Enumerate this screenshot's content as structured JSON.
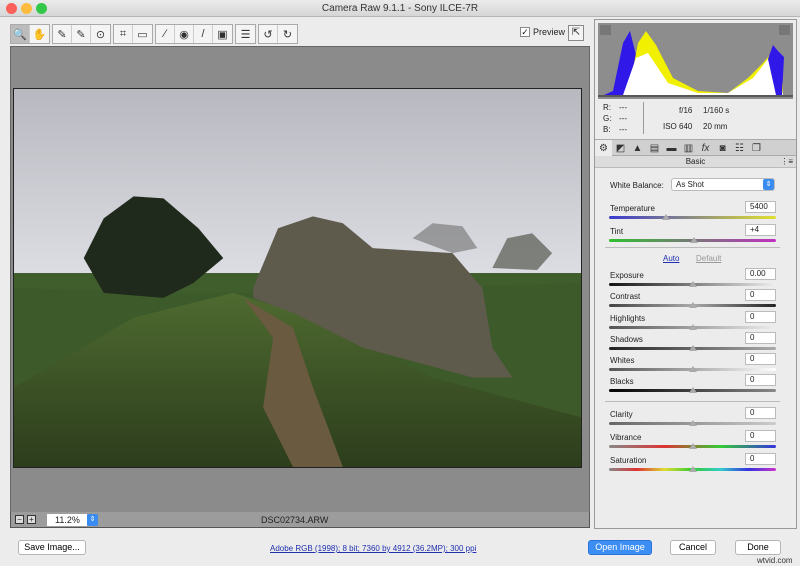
{
  "window": {
    "title": "Camera Raw 9.1.1  -  Sony ILCE-7R"
  },
  "toolbar": {
    "tools": [
      {
        "name": "zoom-tool",
        "glyph": "🔍"
      },
      {
        "name": "hand-tool",
        "glyph": "✋"
      },
      {
        "name": "white-balance-tool",
        "glyph": "✎"
      },
      {
        "name": "color-sampler-tool",
        "glyph": "✎"
      },
      {
        "name": "targeted-adjustment-tool",
        "glyph": "⊙"
      },
      {
        "name": "crop-tool",
        "glyph": "⌗"
      },
      {
        "name": "straighten-tool",
        "glyph": "▭"
      },
      {
        "name": "spot-removal-tool",
        "glyph": "⁄"
      },
      {
        "name": "red-eye-tool",
        "glyph": "◉"
      },
      {
        "name": "adjustment-brush-tool",
        "glyph": "/"
      },
      {
        "name": "graduated-filter-tool",
        "glyph": "▣"
      },
      {
        "name": "preferences-button",
        "glyph": "☰"
      },
      {
        "name": "rotate-left-button",
        "glyph": "↺"
      },
      {
        "name": "rotate-right-button",
        "glyph": "↻"
      }
    ],
    "preview_label": "Preview",
    "preview_checked": true
  },
  "status": {
    "zoom": "11.2%",
    "filename": "DSC02734.ARW"
  },
  "info": {
    "r_label": "R:",
    "g_label": "G:",
    "b_label": "B:",
    "r": "---",
    "g": "---",
    "b": "---",
    "aperture": "f/16",
    "shutter": "1/160 s",
    "iso": "ISO 640",
    "focal": "20 mm"
  },
  "panel": {
    "title": "Basic",
    "white_balance_label": "White Balance:",
    "white_balance": "As Shot",
    "auto": "Auto",
    "default": "Default",
    "sliders": [
      {
        "label": "Temperature",
        "value": "5400",
        "pos": 0.34
      },
      {
        "label": "Tint",
        "value": "+4",
        "pos": 0.51
      },
      {
        "label": "Exposure",
        "value": "0.00",
        "pos": 0.5
      },
      {
        "label": "Contrast",
        "value": "0",
        "pos": 0.5
      },
      {
        "label": "Highlights",
        "value": "0",
        "pos": 0.5
      },
      {
        "label": "Shadows",
        "value": "0",
        "pos": 0.5
      },
      {
        "label": "Whites",
        "value": "0",
        "pos": 0.5
      },
      {
        "label": "Blacks",
        "value": "0",
        "pos": 0.5
      },
      {
        "label": "Clarity",
        "value": "0",
        "pos": 0.5
      },
      {
        "label": "Vibrance",
        "value": "0",
        "pos": 0.5
      },
      {
        "label": "Saturation",
        "value": "0",
        "pos": 0.5
      }
    ]
  },
  "footer": {
    "save": "Save Image...",
    "file_info": "Adobe RGB (1998); 8 bit; 7360 by 4912 (36.2MP); 300 ppi",
    "open": "Open Image",
    "cancel": "Cancel",
    "done": "Done",
    "watermark": "wtvid.com"
  }
}
